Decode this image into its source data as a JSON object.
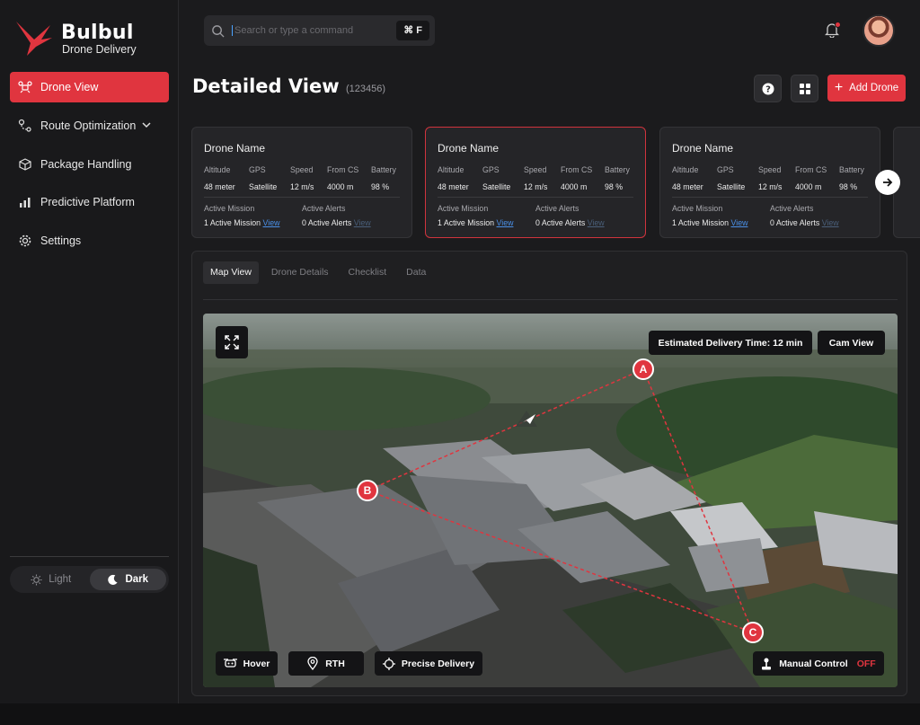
{
  "brand": {
    "name": "Bulbul",
    "tagline": "Drone Delivery",
    "accent": "#e0353f"
  },
  "sidebar": {
    "items": [
      {
        "label": "Drone View",
        "icon": "drone-icon",
        "active": true
      },
      {
        "label": "Route Optimization",
        "icon": "route-icon",
        "has_submenu": true
      },
      {
        "label": "Package Handling",
        "icon": "package-icon"
      },
      {
        "label": "Predictive Platform",
        "icon": "analytics-icon"
      },
      {
        "label": "Settings",
        "icon": "gear-icon"
      }
    ],
    "theme": {
      "light": "Light",
      "dark": "Dark",
      "selected": "Dark"
    }
  },
  "topbar": {
    "search_placeholder": "Search or type a command",
    "shortcut": "⌘ F",
    "notification": "bell-icon"
  },
  "page": {
    "title": "Detailed View",
    "id": "(123456)",
    "add_button": "Add Drone"
  },
  "cards": [
    {
      "name": "Drone Name",
      "selected": false,
      "labels": [
        "Altitude",
        "GPS",
        "Speed",
        "From CS",
        "Battery"
      ],
      "values": [
        "48 meter",
        "Satellite",
        "12 m/s",
        "4000 m",
        "98 %"
      ],
      "mission_label": "Active Mission",
      "mission_value": "1 Active Mission",
      "alerts_label": "Active Alerts",
      "alerts_value": "0 Active Alerts",
      "link": "View"
    },
    {
      "name": "Drone Name",
      "selected": true,
      "labels": [
        "Altitude",
        "GPS",
        "Speed",
        "From CS",
        "Battery"
      ],
      "values": [
        "48 meter",
        "Satellite",
        "12 m/s",
        "4000 m",
        "98 %"
      ],
      "mission_label": "Active Mission",
      "mission_value": "1 Active Mission",
      "alerts_label": "Active Alerts",
      "alerts_value": "0 Active Alerts",
      "link": "View"
    },
    {
      "name": "Drone Name",
      "selected": false,
      "labels": [
        "Altitude",
        "GPS",
        "Speed",
        "From CS",
        "Battery"
      ],
      "values": [
        "48 meter",
        "Satellite",
        "12 m/s",
        "4000 m",
        "98 %"
      ],
      "mission_label": "Active Mission",
      "mission_value": "1 Active Mission",
      "alerts_label": "Active Alerts",
      "alerts_value": "0 Active Alerts",
      "link": "View"
    }
  ],
  "tabs": [
    "Map View",
    "Drone Details",
    "Checklist",
    "Data"
  ],
  "map": {
    "eta": "Estimated Delivery Time: 12 min",
    "cam_view": "Cam View",
    "markers": [
      "A",
      "B",
      "C"
    ],
    "controls": {
      "hover": "Hover",
      "rth": "RTH",
      "precise": "Precise Delivery",
      "manual": "Manual Control",
      "manual_state": "OFF"
    }
  }
}
